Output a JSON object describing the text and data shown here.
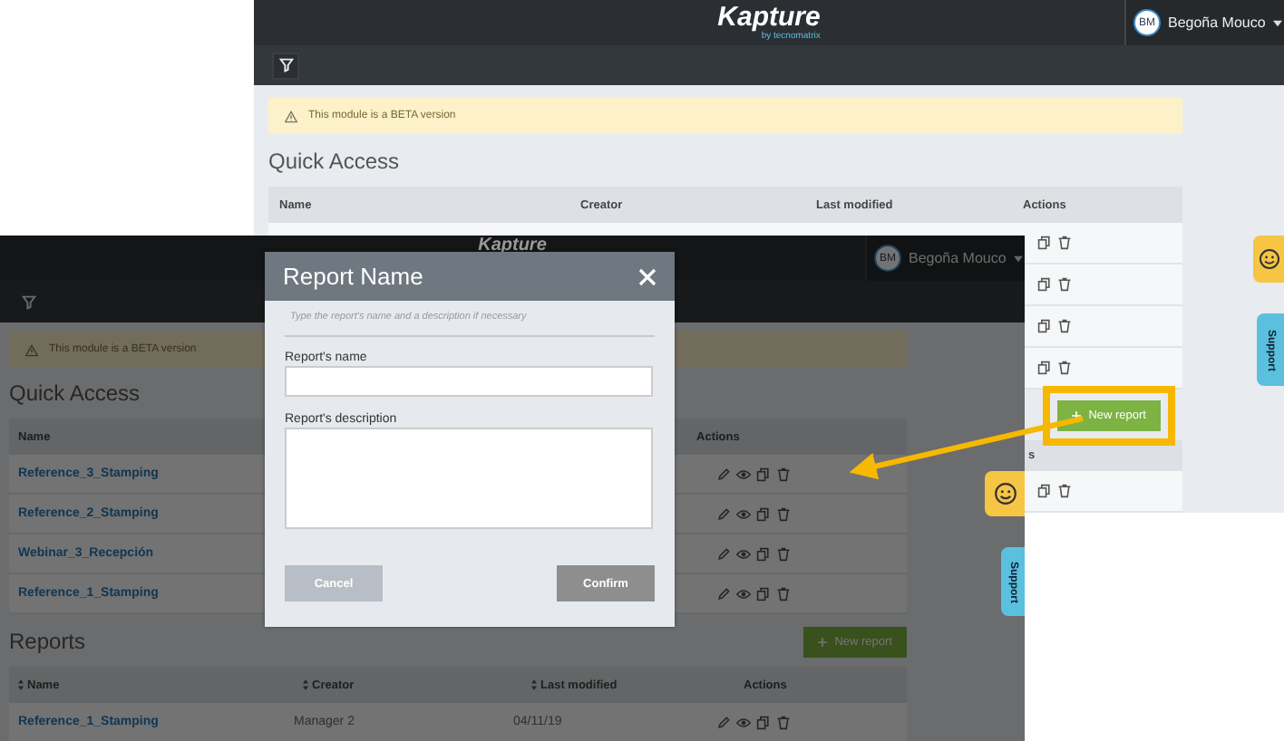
{
  "back_window": {
    "header": {
      "logo": "Kapture",
      "logo_tagline": "by tecnomatrix",
      "avatar_initials": "BM",
      "user_name": "Begoña Mouco"
    },
    "beta_alert": "This module is a BETA version",
    "quick_access": {
      "title": "Quick Access",
      "columns": [
        "Name",
        "Creator",
        "Last modified",
        "Actions"
      ]
    },
    "new_report_button": {
      "label": "New report",
      "highlighted": true
    },
    "reports": {
      "column_cut": "s"
    },
    "support_tab": "Support"
  },
  "front_window": {
    "header": {
      "logo": "Kapture",
      "avatar_initials": "BM",
      "user_name": "Begoña Mouco"
    },
    "beta_alert": "This module is a BETA version",
    "quick_access": {
      "title": "Quick Access",
      "columns": [
        {
          "label": "Name",
          "sortable": false
        },
        {
          "label": "Actions",
          "sortable": false
        }
      ],
      "rows": [
        {
          "name": "Reference_3_Stamping"
        },
        {
          "name": "Reference_2_Stamping"
        },
        {
          "name": "Webinar_3_Recepción"
        },
        {
          "name": "Reference_1_Stamping"
        }
      ]
    },
    "reports": {
      "title": "Reports",
      "new_report_button": "New report",
      "columns": [
        {
          "label": "Name",
          "sortable": true
        },
        {
          "label": "Creator",
          "sortable": true
        },
        {
          "label": "Last modified",
          "sortable": true
        },
        {
          "label": "Actions",
          "sortable": false
        }
      ],
      "rows": [
        {
          "name": "Reference_1_Stamping",
          "creator": "Manager 2",
          "last_modified": "04/11/19"
        }
      ]
    },
    "support_tab": "Support",
    "dialog": {
      "title": "Report Name",
      "hint": "Type the report's name and a description if necessary",
      "fields": [
        {
          "label": "Report's name",
          "kind": "input"
        },
        {
          "label": "Report's description",
          "kind": "textarea"
        }
      ],
      "buttons": [
        {
          "label": "Cancel",
          "kind": "cancel"
        },
        {
          "label": "Confirm",
          "kind": "confirm"
        }
      ]
    }
  }
}
